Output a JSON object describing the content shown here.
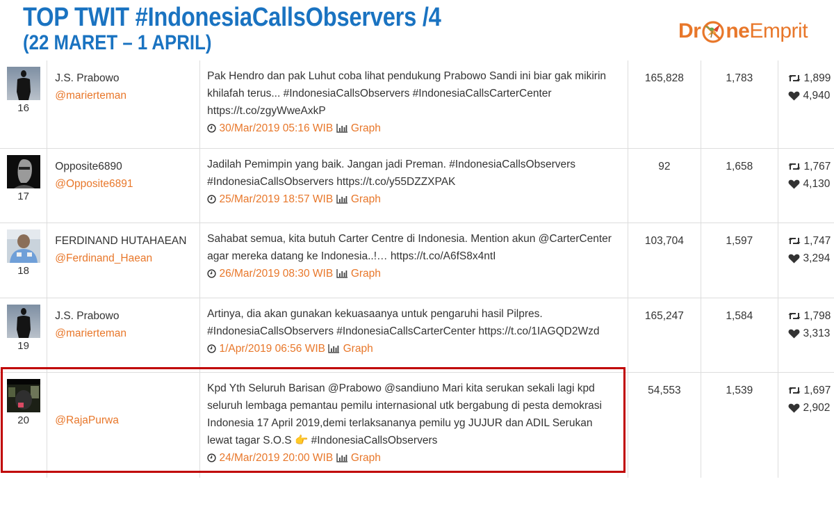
{
  "header": {
    "title_line1": "TOP TWIT #IndonesiaCallsObservers /4",
    "title_line2": "(22 MARET – 1 APRIL)",
    "logo": {
      "part1": "Dr",
      "part2": "ne",
      "part3": "Emprit",
      "brand_color": "#e8772a"
    },
    "title_color": "#1a73c1"
  },
  "colors": {
    "accent_orange": "#e8772a",
    "highlight_red": "#c00000",
    "grid_line": "#dddddd",
    "text": "#333333"
  },
  "icons": {
    "clock": "clock-icon",
    "graph": "bar-chart-icon",
    "retweet": "retweet-icon",
    "like": "heart-icon"
  },
  "rows": [
    {
      "rank": "16",
      "avatar": "silhouette-avatar",
      "name": "J.S. Prabowo",
      "handle": "@marierteman",
      "text": "Pak Hendro dan pak Luhut coba lihat pendukung Prabowo Sandi ini biar gak mikirin khilafah terus... #IndonesiaCallsObservers #IndonesiaCallsCarterCenter https://t.co/zgyWweAxkP",
      "timestamp": "30/Mar/2019 05:16 WIB",
      "graph_label": "Graph",
      "reach": "165,828",
      "count": "1,783",
      "retweets": "1,899",
      "likes": "4,940",
      "highlighted": false
    },
    {
      "rank": "17",
      "avatar": "portrait-avatar",
      "name": "Opposite6890",
      "handle": "@Opposite6891",
      "text": "Jadilah Pemimpin yang baik. Jangan jadi Preman. #IndonesiaCallsObservers #IndonesiaCallsObservers https://t.co/y55DZZXPAK",
      "timestamp": "25/Mar/2019 18:57 WIB",
      "graph_label": "Graph",
      "reach": "92",
      "count": "1,658",
      "retweets": "1,767",
      "likes": "4,130",
      "highlighted": false
    },
    {
      "rank": "18",
      "avatar": "photo-avatar",
      "name": "FERDINAND HUTAHAEAN",
      "handle": "@Ferdinand_Haean",
      "text": "Sahabat semua, kita butuh Carter Centre di Indonesia. Mention akun @CarterCenter agar mereka datang ke Indonesia..!… https://t.co/A6fS8x4ntI",
      "timestamp": "26/Mar/2019 08:30 WIB",
      "graph_label": "Graph",
      "reach": "103,704",
      "count": "1,597",
      "retweets": "1,747",
      "likes": "3,294",
      "highlighted": false
    },
    {
      "rank": "19",
      "avatar": "silhouette-avatar",
      "name": "J.S. Prabowo",
      "handle": "@marierteman",
      "text": "Artinya, dia akan gunakan kekuasaanya untuk pengaruhi hasil Pilpres. #IndonesiaCallsObservers #IndonesiaCallsCarterCenter https://t.co/1IAGQD2Wzd",
      "timestamp": "1/Apr/2019 06:56 WIB",
      "graph_label": "Graph",
      "reach": "165,247",
      "count": "1,584",
      "retweets": "1,798",
      "likes": "3,313",
      "highlighted": false
    },
    {
      "rank": "20",
      "avatar": "dark-photo-avatar",
      "name": "",
      "handle": "@RajaPurwa",
      "text_before_emoji": "Kpd Yth Seluruh Barisan @Prabowo @sandiuno Mari kita serukan sekali lagi kpd seluruh lembaga pemantau pemilu internasional utk bergabung di pesta demokrasi Indonesia 17 April 2019,demi terlaksananya pemilu yg JUJUR dan ADIL Serukan lewat tagar S.O.S",
      "emoji": "👉",
      "text_after_emoji": "#IndonesiaCallsObservers",
      "timestamp": "24/Mar/2019 20:00 WIB",
      "graph_label": "Graph",
      "reach": "54,553",
      "count": "1,539",
      "retweets": "1,697",
      "likes": "2,902",
      "highlighted": true
    }
  ]
}
